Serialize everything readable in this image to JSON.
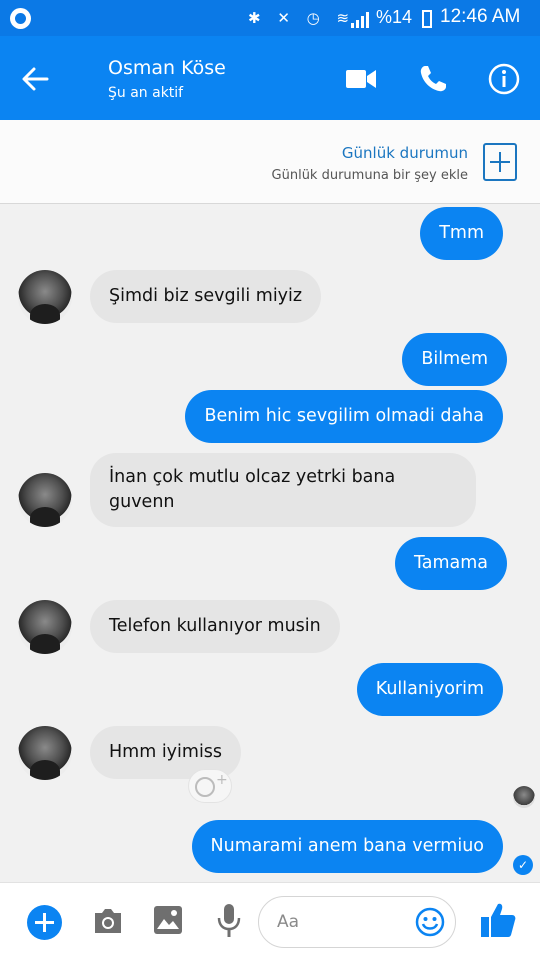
{
  "status_bar": {
    "battery_text": "%14",
    "time": "12:46 AM"
  },
  "header": {
    "contact_name": "Osman Köse",
    "contact_status": "Şu an aktif",
    "icons": [
      "back-arrow-icon",
      "video-camera-icon",
      "phone-icon",
      "info-icon"
    ]
  },
  "story": {
    "title": "Günlük durumun",
    "subtitle": "Günlük durumuna bir şey ekle"
  },
  "messages": [
    {
      "from": "me",
      "text": "Tmm"
    },
    {
      "from": "contact",
      "text": "Şimdi biz sevgili miyiz"
    },
    {
      "from": "me",
      "text": "Bilmem"
    },
    {
      "from": "me",
      "text": "Benim hic sevgilim olmadi daha"
    },
    {
      "from": "contact",
      "text": "İnan çok mutlu olcaz yetrki bana guvenn"
    },
    {
      "from": "me",
      "text": "Tamama"
    },
    {
      "from": "contact",
      "text": "Telefon kullanıyor musin"
    },
    {
      "from": "me",
      "text": "Kullaniyorim"
    },
    {
      "from": "contact",
      "text": "Hmm iyimiss"
    },
    {
      "from": "me",
      "text": "Numarami anem bana vermiuo"
    }
  ],
  "composer": {
    "placeholder": "Aa"
  },
  "colors": {
    "brand": "#0b84f2",
    "incoming_bubble": "#e5e5e5",
    "background": "#f1f1f1"
  }
}
